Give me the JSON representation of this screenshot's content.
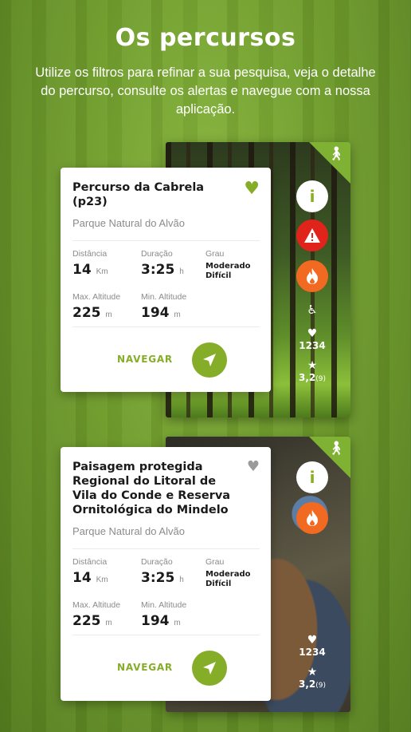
{
  "header": {
    "title": "Os percursos",
    "subtitle": "Utilize os filtros para refinar a sua pesquisa, veja o detalhe do percurso, consulte os alertas e navegue com a nossa aplicação."
  },
  "colors": {
    "accent": "#86ad28",
    "alert": "#e0241b",
    "fire": "#f26a21",
    "fav_active": "#86ad28",
    "fav_inactive": "#9a9a9a"
  },
  "cards": [
    {
      "title": "Percurso da Cabrela (p23)",
      "park": "Parque Natural do Alvão",
      "favorite": true,
      "distance_label": "Distância",
      "distance_value": "14",
      "distance_unit": "Km",
      "duration_label": "Duração",
      "duration_value": "3:25",
      "duration_unit": "h",
      "grade_label": "Grau",
      "grade_value": "Moderado Difícil",
      "max_alt_label": "Max. Altitude",
      "max_alt_value": "225",
      "max_alt_unit": "m",
      "min_alt_label": "Min. Altitude",
      "min_alt_value": "194",
      "min_alt_unit": "m",
      "navigate_label": "NAVEGAR",
      "likes": "1234",
      "rating": "3,2",
      "rating_count": "(9)",
      "icons": [
        "hiker-icon",
        "info-icon",
        "alert-icon",
        "fire-icon",
        "accessible-icon",
        "heart-icon",
        "star-icon",
        "navigation-arrow-icon"
      ]
    },
    {
      "title": "Paisagem protegida Regional do Litoral de Vila do Conde e Reserva Ornitológica do Mindelo",
      "park": "Parque Natural do Alvão",
      "favorite": false,
      "distance_label": "Distância",
      "distance_value": "14",
      "distance_unit": "Km",
      "duration_label": "Duração",
      "duration_value": "3:25",
      "duration_unit": "h",
      "grade_label": "Grau",
      "grade_value": "Moderado Difícil",
      "max_alt_label": "Max. Altitude",
      "max_alt_value": "225",
      "max_alt_unit": "m",
      "min_alt_label": "Min. Altitude",
      "min_alt_value": "194",
      "min_alt_unit": "m",
      "navigate_label": "NAVEGAR",
      "likes": "1234",
      "rating": "3,2",
      "rating_count": "(9)",
      "icons": [
        "hiker-icon",
        "info-icon",
        "fire-icon",
        "heart-icon",
        "star-icon",
        "navigation-arrow-icon"
      ]
    }
  ]
}
